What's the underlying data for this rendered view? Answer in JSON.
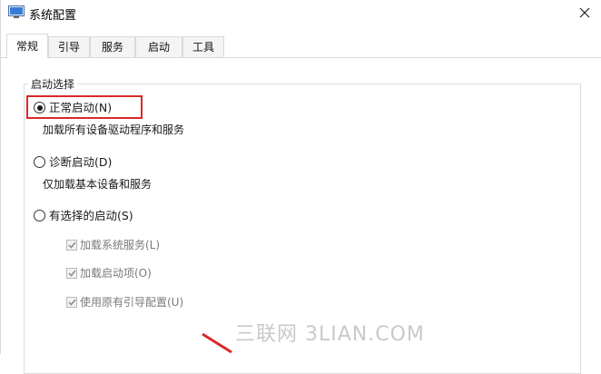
{
  "window": {
    "title": "系统配置",
    "icon": "system-config-app-icon"
  },
  "tabs": [
    {
      "label": "常规",
      "active": true
    },
    {
      "label": "引导",
      "active": false
    },
    {
      "label": "服务",
      "active": false
    },
    {
      "label": "启动",
      "active": false
    },
    {
      "label": "工具",
      "active": false
    }
  ],
  "startup_selection": {
    "legend": "启动选择",
    "options": [
      {
        "label": "正常启动(N)",
        "description": "加载所有设备驱动程序和服务",
        "selected": true
      },
      {
        "label": "诊断启动(D)",
        "description": "仅加载基本设备和服务",
        "selected": false
      },
      {
        "label": "有选择的启动(S)",
        "selected": false
      }
    ],
    "selective_items": [
      {
        "label": "加载系统服务(L)",
        "checked": true,
        "enabled": false
      },
      {
        "label": "加载启动项(O)",
        "checked": true,
        "enabled": false
      },
      {
        "label": "使用原有引导配置(U)",
        "checked": true,
        "enabled": false
      }
    ]
  },
  "annotations": {
    "highlight_color": "#d92a2a",
    "watermark": "三联网 3LIAN.COM"
  }
}
